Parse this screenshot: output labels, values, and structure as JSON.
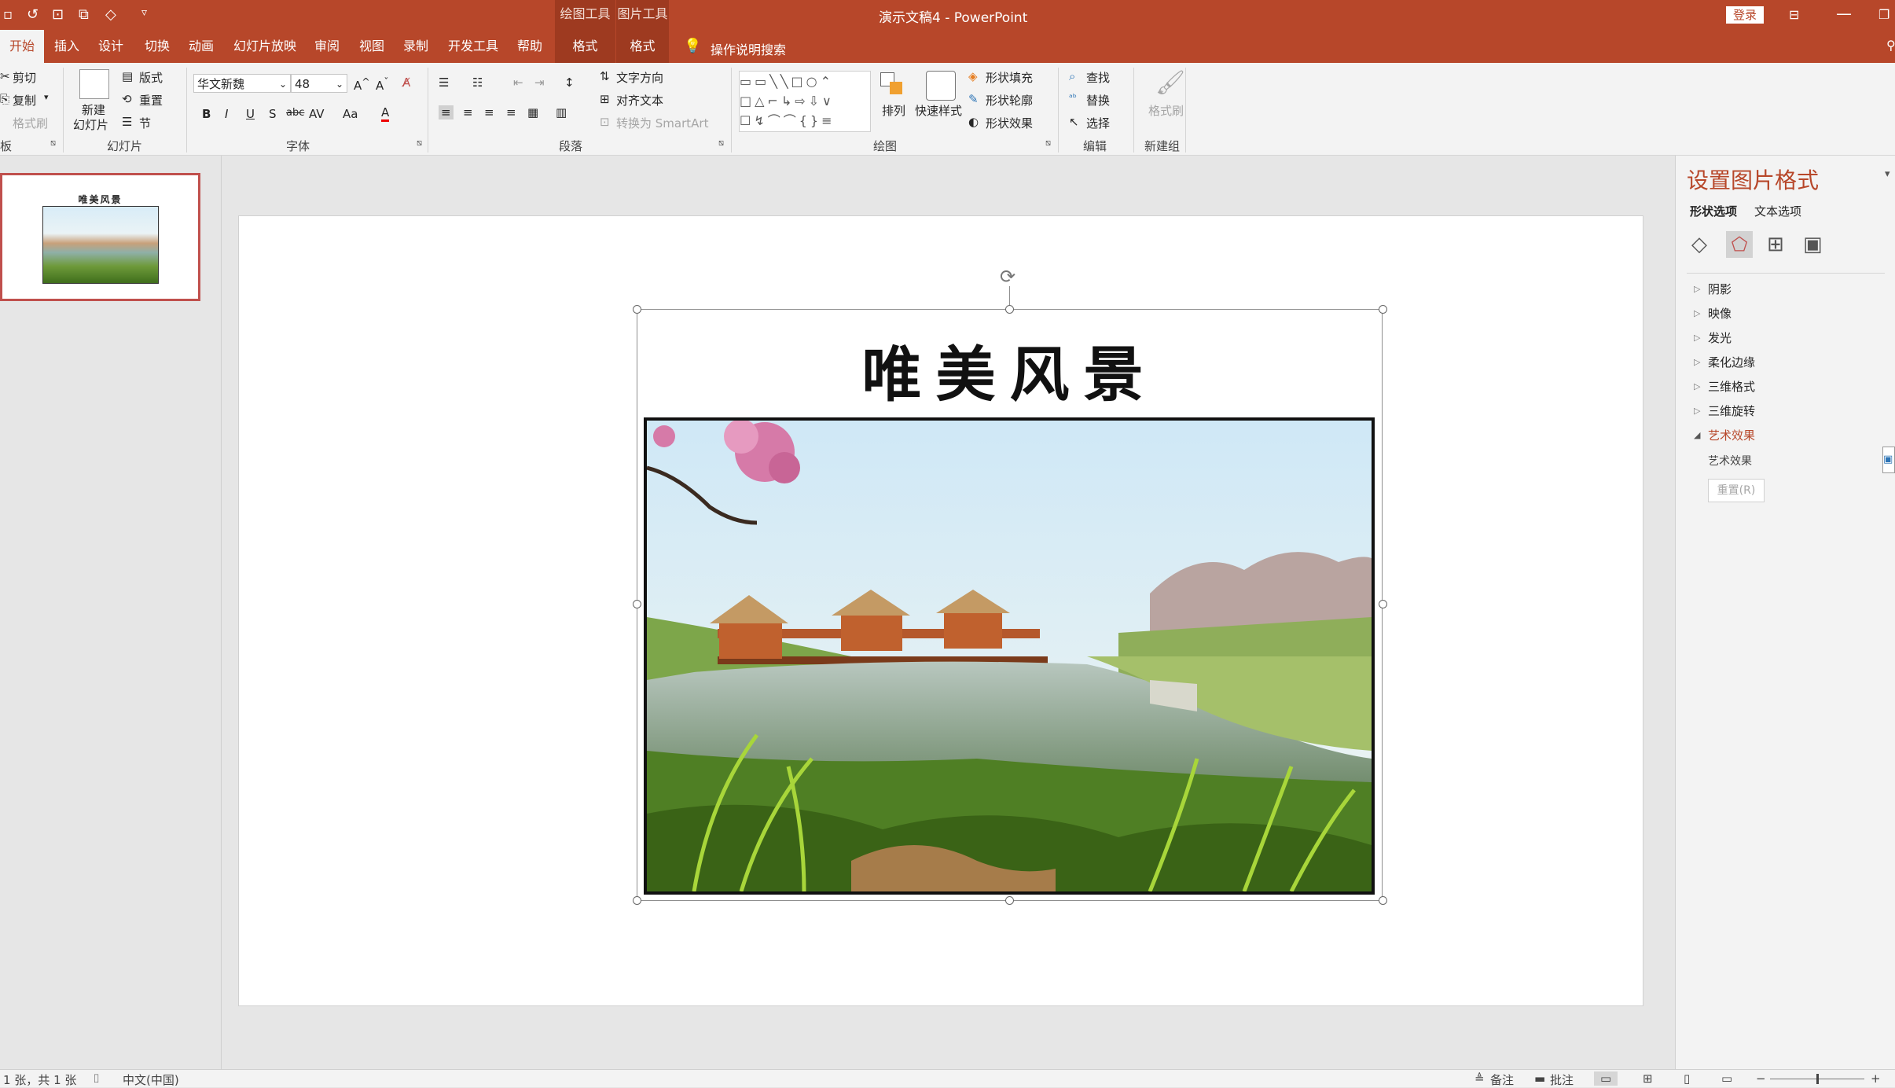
{
  "titlebar": {
    "context_groups": [
      "绘图工具",
      "图片工具"
    ],
    "window_title": "演示文稿4  -  PowerPoint",
    "login_label": "登录"
  },
  "tabs": {
    "items": [
      "开始",
      "插入",
      "设计",
      "切换",
      "动画",
      "幻灯片放映",
      "审阅",
      "视图",
      "录制",
      "开发工具",
      "帮助",
      "格式",
      "格式"
    ],
    "search_label": "操作说明搜索"
  },
  "ribbon": {
    "clipboard": {
      "cut": "剪切",
      "copy": "复制",
      "format_painter": "格式刷",
      "group_label": "板"
    },
    "slides": {
      "new_slide_line1": "新建",
      "new_slide_line2": "幻灯片",
      "layout": "版式",
      "reset": "重置",
      "section": "节",
      "group_label": "幻灯片"
    },
    "font": {
      "font_name": "华文新魏",
      "font_size": "48",
      "group_label": "字体"
    },
    "paragraph": {
      "text_direction": "文字方向",
      "align_text": "对齐文本",
      "convert_smartart": "转换为 SmartArt",
      "group_label": "段落"
    },
    "drawing": {
      "arrange": "排列",
      "quick_styles": "快速样式",
      "shape_fill": "形状填充",
      "shape_outline": "形状轮廓",
      "shape_effects": "形状效果",
      "group_label": "绘图"
    },
    "editing": {
      "find": "查找",
      "replace": "替换",
      "select": "选择",
      "group_label": "编辑"
    },
    "new_group": {
      "format_painter": "格式刷",
      "group_label": "新建组"
    }
  },
  "thumbnail": {
    "title": "唯美风景"
  },
  "slide": {
    "title": "唯美风景"
  },
  "format_pane": {
    "title": "设置图片格式",
    "tab_shape": "形状选项",
    "tab_text": "文本选项",
    "sections": [
      "阴影",
      "映像",
      "发光",
      "柔化边缘",
      "三维格式",
      "三维旋转",
      "艺术效果"
    ],
    "art_effect_label": "艺术效果",
    "reset_label": "重置(R)"
  },
  "statusbar": {
    "slide_count": "1 张，共 1 张",
    "language": "中文(中国)",
    "notes": "备注",
    "comments": "批注"
  },
  "colors": {
    "accent": "#b7472a",
    "ribbon_bg": "#f3f3f3",
    "workspace_bg": "#e6e6e6"
  }
}
